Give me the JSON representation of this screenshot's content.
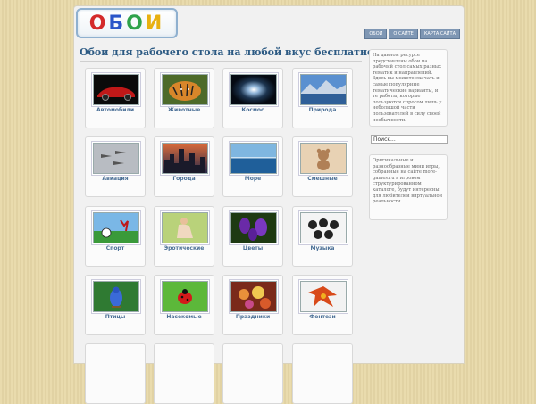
{
  "logo": {
    "letters": [
      {
        "ch": "О",
        "color": "#d42a2a"
      },
      {
        "ch": "Б",
        "color": "#2a55c8"
      },
      {
        "ch": "О",
        "color": "#2ea24a"
      },
      {
        "ch": "И",
        "color": "#e8b010"
      }
    ]
  },
  "nav": [
    "ОБОИ",
    "О САЙТЕ",
    "КАРТА САЙТА"
  ],
  "heading": "Обои для рабочего стола на любой вкус бесплатно:",
  "categories": [
    {
      "label": "Автомобили",
      "icon": "car-icon"
    },
    {
      "label": "Животные",
      "icon": "tiger-icon"
    },
    {
      "label": "Космос",
      "icon": "space-icon"
    },
    {
      "label": "Природа",
      "icon": "mountain-lake-icon"
    },
    {
      "label": "Авиация",
      "icon": "jets-icon"
    },
    {
      "label": "Города",
      "icon": "city-icon"
    },
    {
      "label": "Море",
      "icon": "sea-icon"
    },
    {
      "label": "Смешные",
      "icon": "teddy-bear-icon"
    },
    {
      "label": "Спорт",
      "icon": "soccer-icon"
    },
    {
      "label": "Эротические",
      "icon": "woman-icon"
    },
    {
      "label": "Цветы",
      "icon": "flowers-icon"
    },
    {
      "label": "Музыка",
      "icon": "band-icon"
    },
    {
      "label": "Птицы",
      "icon": "bird-icon"
    },
    {
      "label": "Насекомые",
      "icon": "ladybug-icon"
    },
    {
      "label": "Праздники",
      "icon": "festive-icon"
    },
    {
      "label": "Фентези",
      "icon": "fantasy-icon"
    }
  ],
  "sidebar": {
    "about": "На данном ресурсе представлены обои на рабочий стол самых разных тематик и направлений. Здесь вы можете скачать и самые популярные тематические варианты, и те работы, которые пользуются спросом лишь у небольшой части пользователей в силу своей необычности.",
    "search_placeholder": "Поиск...",
    "games": "Оригинальные и разнообразные мини игры, собранные на сайте more-games.ru в игровом структурированном каталоге, будут интересны для любителей виртуальной реальности."
  }
}
